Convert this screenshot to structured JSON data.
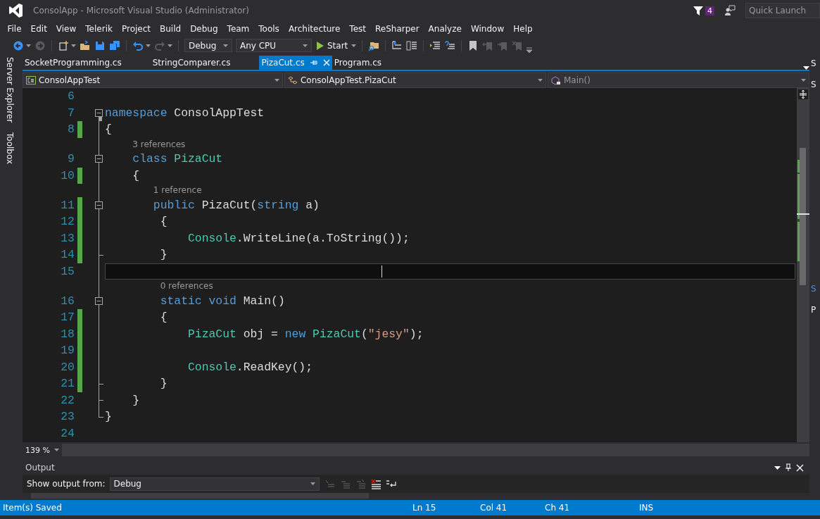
{
  "window": {
    "title": "ConsolApp - Microsoft Visual Studio (Administrator)",
    "notification_count": "4",
    "quick_launch": {
      "placeholder": "Quick Launch"
    }
  },
  "menu": [
    "File",
    "Edit",
    "View",
    "Telerik",
    "Project",
    "Build",
    "Debug",
    "Team",
    "Tools",
    "Architecture",
    "Test",
    "ReSharper",
    "Analyze",
    "Window",
    "Help"
  ],
  "toolbar": [
    {
      "kind": "back",
      "disabled": false
    },
    {
      "kind": "forward",
      "disabled": true
    },
    {
      "kind": "separator"
    },
    {
      "kind": "new-project",
      "disabled": false
    },
    {
      "kind": "open",
      "disabled": false
    },
    {
      "kind": "save",
      "disabled": false
    },
    {
      "kind": "save-all",
      "disabled": false
    },
    {
      "kind": "separator"
    },
    {
      "kind": "undo",
      "disabled": false
    },
    {
      "kind": "redo",
      "disabled": true
    },
    {
      "kind": "separator"
    },
    {
      "kind": "select",
      "value": "Debug"
    },
    {
      "kind": "select",
      "value": "Any CPU"
    },
    {
      "kind": "start",
      "label": "Start"
    },
    {
      "kind": "separator"
    },
    {
      "kind": "find",
      "disabled": false
    },
    {
      "kind": "separator"
    },
    {
      "kind": "tree",
      "disabled": false
    },
    {
      "kind": "columns",
      "disabled": false
    },
    {
      "kind": "separator"
    },
    {
      "kind": "lines",
      "disabled": false
    },
    {
      "kind": "lines-alt",
      "disabled": false
    },
    {
      "kind": "separator"
    },
    {
      "kind": "bookmark",
      "disabled": false
    },
    {
      "kind": "bookmark-prev",
      "disabled": true
    },
    {
      "kind": "bookmark-next",
      "disabled": true
    },
    {
      "kind": "bookmark-clear",
      "disabled": true
    },
    {
      "kind": "overflow"
    }
  ],
  "side_tabs": [
    "Server Explorer",
    "Toolbox"
  ],
  "tabs": [
    {
      "label": "SocketProgramming.cs",
      "selected": false
    },
    {
      "label": "StringComparer.cs",
      "selected": false
    },
    {
      "label": "PizaCut.cs",
      "selected": true
    },
    {
      "label": "Program.cs",
      "selected": false
    }
  ],
  "nav_bar": {
    "project": "ConsolAppTest",
    "type": "ConsolAppTest.PizaCut",
    "member": "Main()"
  },
  "lines": [
    {
      "kind": "code",
      "number": "6",
      "changed": false,
      "current": false,
      "foldable": false,
      "block_end": false
    },
    {
      "kind": "code",
      "number": "7",
      "changed": false,
      "current": false,
      "foldable": true,
      "block_end": false,
      "tokens": [
        {
          "kind": "keyword",
          "text": "namespace"
        },
        {
          "kind": "plain",
          "text": " ConsolAppTest"
        }
      ]
    },
    {
      "kind": "code",
      "number": "8",
      "changed": true,
      "current": false,
      "foldable": false,
      "block_end": false,
      "tokens": [
        {
          "kind": "plain",
          "text": "{"
        }
      ]
    },
    {
      "kind": "codelens",
      "text": "3 references"
    },
    {
      "kind": "code",
      "number": "9",
      "changed": false,
      "current": false,
      "foldable": true,
      "block_end": false,
      "tokens": [
        {
          "kind": "keyword",
          "text": "class"
        },
        {
          "kind": "type",
          "text": " PizaCut"
        }
      ]
    },
    {
      "kind": "code",
      "number": "10",
      "changed": true,
      "current": false,
      "foldable": false,
      "block_end": false,
      "tokens": [
        {
          "kind": "plain",
          "text": "{"
        }
      ]
    },
    {
      "kind": "codelens",
      "text": "1 reference"
    },
    {
      "kind": "code",
      "number": "11",
      "changed": true,
      "current": false,
      "foldable": true,
      "block_end": false,
      "tokens": [
        {
          "kind": "keyword",
          "text": "public"
        },
        {
          "kind": "plain",
          "text": " PizaCut("
        },
        {
          "kind": "keyword",
          "text": "string"
        },
        {
          "kind": "plain",
          "text": " a)"
        }
      ]
    },
    {
      "kind": "code",
      "number": "12",
      "changed": true,
      "current": false,
      "foldable": false,
      "block_end": false,
      "tokens": [
        {
          "kind": "plain",
          "text": "{"
        }
      ]
    },
    {
      "kind": "code",
      "number": "13",
      "changed": true,
      "current": false,
      "foldable": false,
      "block_end": false,
      "tokens": [
        {
          "kind": "type",
          "text": "Console"
        },
        {
          "kind": "plain",
          "text": ".WriteLine(a.ToString());"
        }
      ]
    },
    {
      "kind": "code",
      "number": "14",
      "changed": true,
      "current": false,
      "foldable": false,
      "block_end": true,
      "tokens": [
        {
          "kind": "plain",
          "text": "}"
        }
      ]
    },
    {
      "kind": "code",
      "number": "15",
      "changed": false,
      "current": true,
      "foldable": false,
      "block_end": false
    },
    {
      "kind": "codelens",
      "text": "0 references"
    },
    {
      "kind": "code",
      "number": "16",
      "changed": false,
      "current": false,
      "foldable": true,
      "block_end": false,
      "tokens": [
        {
          "kind": "keyword",
          "text": "static"
        },
        {
          "kind": "keyword",
          "text": " void"
        },
        {
          "kind": "plain",
          "text": " Main()"
        }
      ]
    },
    {
      "kind": "code",
      "number": "17",
      "changed": true,
      "current": false,
      "foldable": false,
      "block_end": false,
      "tokens": [
        {
          "kind": "plain",
          "text": "{"
        }
      ]
    },
    {
      "kind": "code",
      "number": "18",
      "changed": true,
      "current": false,
      "foldable": false,
      "block_end": false,
      "tokens": [
        {
          "kind": "type",
          "text": "PizaCut"
        },
        {
          "kind": "plain",
          "text": " obj = "
        },
        {
          "kind": "keyword",
          "text": "new"
        },
        {
          "kind": "type",
          "text": " PizaCut"
        },
        {
          "kind": "plain",
          "text": "("
        },
        {
          "kind": "string",
          "text": "\"jesy\""
        },
        {
          "kind": "plain",
          "text": ");"
        }
      ]
    },
    {
      "kind": "code",
      "number": "19",
      "changed": true,
      "current": false,
      "foldable": false,
      "block_end": false
    },
    {
      "kind": "code",
      "number": "20",
      "changed": true,
      "current": false,
      "foldable": false,
      "block_end": false,
      "tokens": [
        {
          "kind": "type",
          "text": "Console"
        },
        {
          "kind": "plain",
          "text": ".ReadKey();"
        }
      ]
    },
    {
      "kind": "code",
      "number": "21",
      "changed": true,
      "current": false,
      "foldable": false,
      "block_end": true,
      "tokens": [
        {
          "kind": "plain",
          "text": "}"
        }
      ]
    },
    {
      "kind": "code",
      "number": "22",
      "changed": false,
      "current": false,
      "foldable": false,
      "block_end": true,
      "tokens": [
        {
          "kind": "plain",
          "text": "}"
        }
      ]
    },
    {
      "kind": "code",
      "number": "23",
      "changed": false,
      "current": false,
      "foldable": false,
      "block_end": true,
      "tokens": [
        {
          "kind": "plain",
          "text": "}"
        }
      ]
    },
    {
      "kind": "code",
      "number": "24",
      "changed": false,
      "current": false,
      "foldable": false,
      "block_end": false
    }
  ],
  "zoom": "139 %",
  "output": {
    "title": "Output",
    "source_label": "Show output from:",
    "source": "Debug"
  },
  "right_panel": [
    "S",
    "S",
    "S",
    "P"
  ],
  "status_bar": {
    "message": "Item(s) Saved",
    "line": "Ln 15",
    "column": "Col 41",
    "char": "Ch 41",
    "mode": "INS"
  }
}
